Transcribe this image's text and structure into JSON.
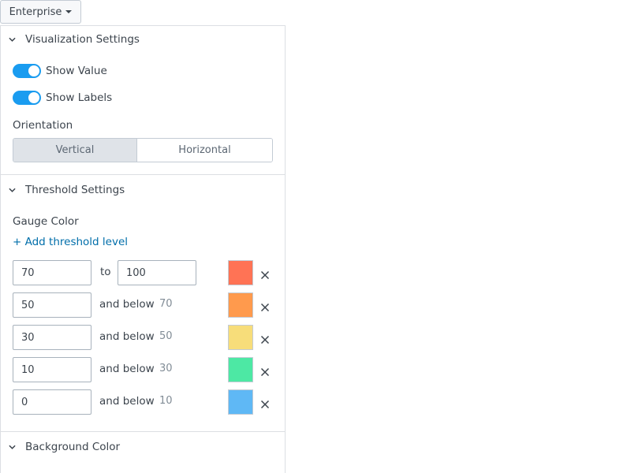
{
  "env_menu": {
    "label": "Enterprise",
    "icon": "caret-down-icon"
  },
  "visualization": {
    "title": "Visualization Settings",
    "show_value": {
      "label": "Show Value",
      "on": true
    },
    "show_labels": {
      "label": "Show Labels",
      "on": true
    },
    "orientation_label": "Orientation",
    "orientation_options": [
      "Vertical",
      "Horizontal"
    ],
    "orientation_selected": "Vertical"
  },
  "threshold": {
    "title": "Threshold Settings",
    "gauge_color_label": "Gauge Color",
    "add_link": "+ Add threshold level",
    "top_row": {
      "from": "70",
      "to_label": "to",
      "to": "100",
      "color": "#ff7355"
    },
    "rows": [
      {
        "value": "50",
        "label": "and below",
        "upper": "70",
        "color": "#ff9a4d"
      },
      {
        "value": "30",
        "label": "and below",
        "upper": "50",
        "color": "#f7dd7a"
      },
      {
        "value": "10",
        "label": "and below",
        "upper": "30",
        "color": "#4de8a4"
      },
      {
        "value": "0",
        "label": "and below",
        "upper": "10",
        "color": "#5fb8f5"
      }
    ]
  },
  "background": {
    "title": "Background Color"
  },
  "colors": {
    "toggle_on": "#1a9cf0",
    "link": "#006eaa"
  }
}
